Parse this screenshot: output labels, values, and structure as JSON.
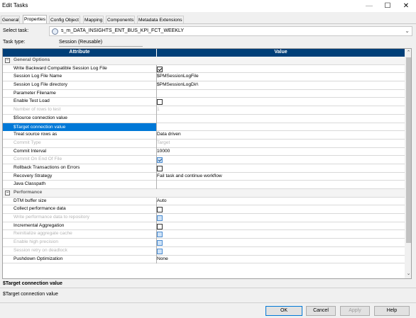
{
  "window": {
    "title": "Edit Tasks",
    "controls": {
      "minimize": "—",
      "maximize": "☐",
      "close": "✕"
    }
  },
  "tabs": [
    {
      "label": "General",
      "active": false
    },
    {
      "label": "Properties",
      "active": true
    },
    {
      "label": "Config Object",
      "active": false
    },
    {
      "label": "Mapping",
      "active": false
    },
    {
      "label": "Components",
      "active": false
    },
    {
      "label": "Metadata Extensions",
      "active": false
    }
  ],
  "task": {
    "select_label": "Select task:",
    "select_value": "s_m_DATA_INSIGHTS_ENT_BUS_KPI_FCT_WEEKLY",
    "type_label": "Task type:",
    "type_value": "Session (Reusable)"
  },
  "grid": {
    "headers": {
      "attribute": "Attribute",
      "value": "Value"
    },
    "rows": [
      {
        "kind": "group",
        "attr": "General Options"
      },
      {
        "attr": "Write Backward Compatible Session Log File",
        "type": "checkbox",
        "checked": true
      },
      {
        "attr": "Session Log File Name",
        "value": "$PMSessionLogFile"
      },
      {
        "attr": "Session Log File directory",
        "value": "$PMSessionLogDir\\"
      },
      {
        "attr": "Parameter Filename",
        "value": ""
      },
      {
        "attr": "Enable Test Load",
        "type": "checkbox",
        "checked": false
      },
      {
        "attr": "Number of rows to test",
        "value": "1",
        "disabled": true
      },
      {
        "attr": "$Source connection value",
        "value": ""
      },
      {
        "attr": "$Target connection value",
        "value": "",
        "selected": true
      },
      {
        "attr": "Treat source rows as",
        "value": "Data driven"
      },
      {
        "attr": "Commit Type",
        "value": "Target",
        "disabled": true
      },
      {
        "attr": "Commit Interval",
        "value": "10000"
      },
      {
        "attr": "Commit On End Of File",
        "type": "checkbox",
        "checked": true,
        "disabled": true
      },
      {
        "attr": "Rollback Transactions on Errors",
        "type": "checkbox",
        "checked": false
      },
      {
        "attr": "Recovery Strategy",
        "value": "Fail task and continue workflow"
      },
      {
        "attr": "Java Classpath",
        "value": ""
      },
      {
        "kind": "group",
        "attr": "Performance"
      },
      {
        "attr": "DTM buffer size",
        "value": "Auto"
      },
      {
        "attr": "Collect performance data",
        "type": "checkbox",
        "checked": false
      },
      {
        "attr": "Write performance data to repository",
        "type": "checkbox",
        "checked": false,
        "disabled": true
      },
      {
        "attr": "Incremental Aggregation",
        "type": "checkbox",
        "checked": false
      },
      {
        "attr": "Reinitialize aggregate cache",
        "type": "checkbox",
        "checked": false,
        "disabled": true
      },
      {
        "attr": "Enable high precision",
        "type": "checkbox",
        "checked": false,
        "disabled": true
      },
      {
        "attr": "Session retry on deadlock",
        "type": "checkbox",
        "checked": false,
        "disabled": true
      },
      {
        "attr": "Pushdown Optimization",
        "value": "None"
      }
    ]
  },
  "description": {
    "title": "$Target connection value",
    "text": "$Target connection value"
  },
  "buttons": {
    "ok": "OK",
    "cancel": "Cancel",
    "apply": "Apply",
    "help": "Help"
  }
}
